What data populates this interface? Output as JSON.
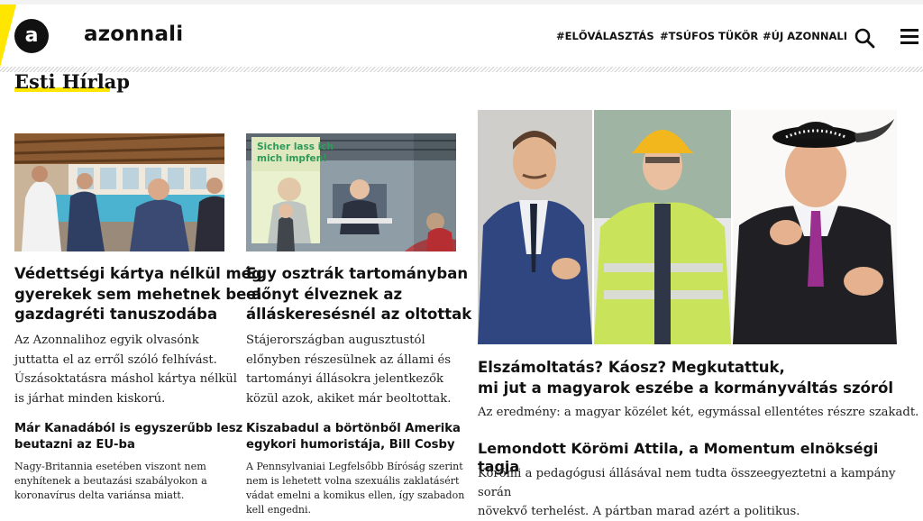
{
  "brand": {
    "logo_mark": "a",
    "name": "azonnali"
  },
  "nav": {
    "items": [
      {
        "label": "#ELŐVÁLASZTÁS"
      },
      {
        "label": "#TSÚFOS TÜKÖR"
      },
      {
        "label": "#ÚJ AZONNALI"
      }
    ],
    "search_icon": "search-icon",
    "menu_icon": "hamburger-menu-icon"
  },
  "colors": {
    "accent": "#ffe600",
    "text": "#111111",
    "logo_bg": "#111111"
  },
  "section": {
    "title": "Esti Hírlap"
  },
  "articles": [
    {
      "title_lines": [
        "Védettségi kártya nélkül még",
        "gyerekek sem mehetnek be a",
        "gazdagréti tanuszodába"
      ],
      "lead_lines": [
        "Az Azonnalihoz egyik olvasónk",
        "juttatta el az erről szóló felhívást.",
        "Úszásoktatásra máshol kártya nélkül",
        "is járhat minden kiskorú."
      ],
      "image": "photo-swimming-pool-meeting"
    },
    {
      "title_lines": [
        "Egy osztrák tartományban",
        "előnyt élveznek az",
        "álláskeresésnél az oltottak"
      ],
      "lead_lines": [
        "Stájerországban augusztustól",
        "előnyben részesülnek az állami és",
        "tartományi állásokra jelentkezők",
        "közül azok, akiket már beoltottak."
      ],
      "image": "photo-press-conference",
      "image_sign_lines": [
        "Sicher lass ich",
        "mich impfen!"
      ]
    },
    {
      "title_lines": [
        "Elszámoltatás? Káosz? Megkutattuk,",
        "mi jut a magyarok eszébe a kormányváltás szóról"
      ],
      "lead": "Az eredmény: a magyar közélet két, egymással ellentétes részre szakadt.",
      "image": "photo-three-politicians"
    }
  ],
  "secondary": [
    {
      "title_lines": [
        "Már Kanadából is egyszerűbb lesz",
        "beutazni az EU-ba"
      ],
      "lead_lines": [
        "Nagy-Britannia esetében viszont nem",
        "enyhítenek a beutazási szabályokon a",
        "koronavírus delta variánsa miatt."
      ]
    },
    {
      "title_lines": [
        "Kiszabadul a börtönből Amerika",
        "egykori humoristája, Bill Cosby"
      ],
      "lead_lines": [
        "A Pennsylvaniai Legfelsőbb Bíróság szerint",
        "nem is lehetett volna szexuális zaklatásért",
        "vádat emelni a komikus ellen, így szabadon",
        "kell engedni."
      ]
    },
    {
      "title": "Lemondott Körömi Attila, a Momentum elnökségi tagja",
      "lead_lines": [
        "Körömi a pedagógusi állásával nem tudta összeegyeztetni a kampány során",
        "növekvő terhelést. A pártban marad azért a politikus."
      ]
    }
  ]
}
